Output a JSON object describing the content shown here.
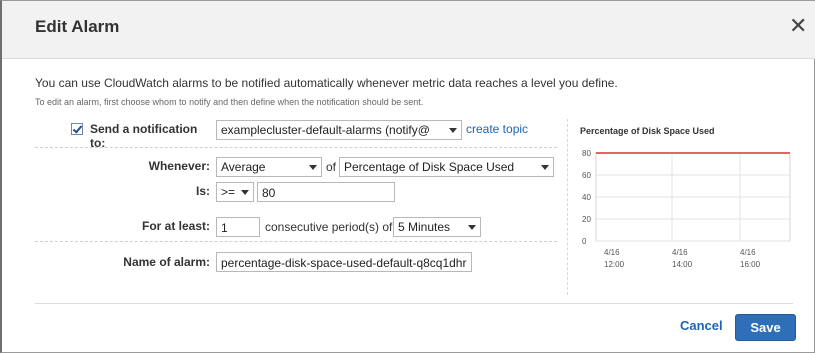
{
  "dialog": {
    "title": "Edit Alarm",
    "close_glyph": "✕"
  },
  "intro": {
    "line1": "You can use CloudWatch alarms to be notified automatically whenever metric data reaches a level you define.",
    "line2": "To edit an alarm, first choose whom to notify and then define when the notification should be sent."
  },
  "form": {
    "notification": {
      "checked": true,
      "label": "Send a notification to:",
      "topic": "examplecluster-default-alarms (notify@",
      "create_topic": "create topic"
    },
    "whenever": {
      "label": "Whenever:",
      "statistic": "Average",
      "of_text": "of",
      "metric": "Percentage of Disk Space Used"
    },
    "is": {
      "label": "Is:",
      "operator": ">=",
      "threshold": "80"
    },
    "for_at_least": {
      "label": "For at least:",
      "periods": "1",
      "middle_text": "consecutive period(s) of",
      "period_length": "5 Minutes"
    },
    "name": {
      "label": "Name of alarm:",
      "value": "percentage-disk-space-used-default-q8cq1dhr"
    }
  },
  "chart_data": {
    "type": "line",
    "title": "Percentage of Disk Space Used",
    "ylim": [
      0,
      80
    ],
    "yticks": [
      "80",
      "60",
      "40",
      "20",
      "0"
    ],
    "x_ticks": [
      {
        "date": "4/16",
        "time": "12:00"
      },
      {
        "date": "4/16",
        "time": "14:00"
      },
      {
        "date": "4/16",
        "time": "16:00"
      }
    ],
    "series": [
      {
        "values": [
          80,
          80,
          80,
          80
        ],
        "color": "#e06666"
      }
    ],
    "grid": true
  },
  "footer": {
    "cancel_label": "Cancel",
    "save_label": "Save"
  },
  "colors": {
    "accent": "#2f6fb8",
    "link": "#1a66b8",
    "threshold_line": "#e06666"
  }
}
